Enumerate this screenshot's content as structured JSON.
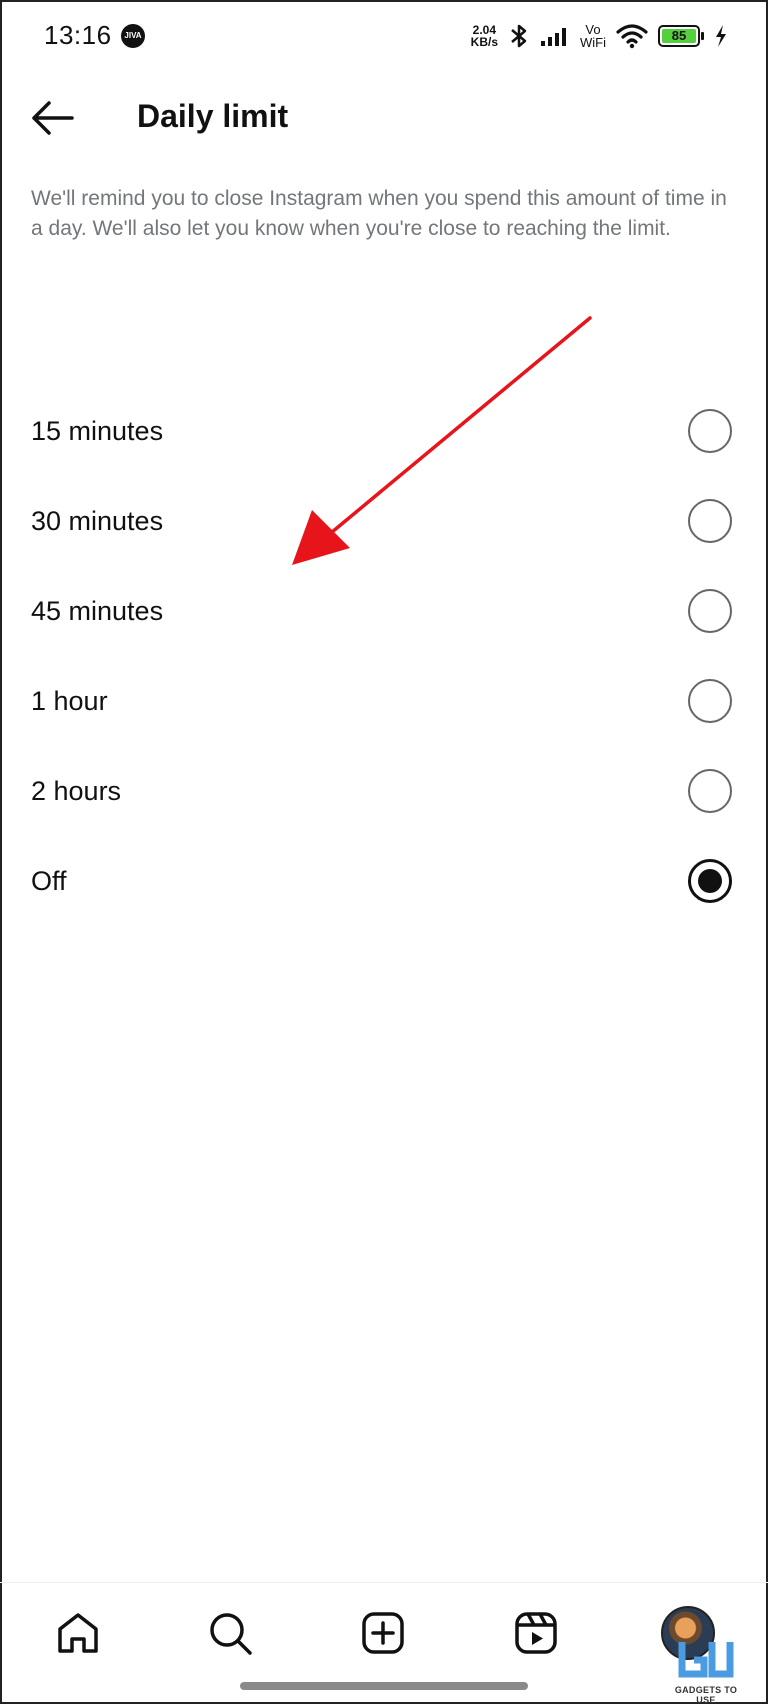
{
  "status_bar": {
    "time": "13:16",
    "app_icon_text": "JIVA",
    "net_speed_value": "2.04",
    "net_speed_unit": "KB/s",
    "vo_label": "Vo",
    "wifi_label": "WiFi",
    "battery_level": "85"
  },
  "header": {
    "title": "Daily limit"
  },
  "description": "We'll remind you to close Instagram when you spend this amount of time in a day. We'll also let you know when you're close to reaching the limit.",
  "options": [
    {
      "label": "15 minutes",
      "selected": false
    },
    {
      "label": "30 minutes",
      "selected": false
    },
    {
      "label": "45 minutes",
      "selected": false
    },
    {
      "label": "1 hour",
      "selected": false
    },
    {
      "label": "2 hours",
      "selected": false
    },
    {
      "label": "Off",
      "selected": true
    }
  ],
  "bottom_nav": [
    "home-icon",
    "search-icon",
    "create-icon",
    "reels-icon",
    "profile-avatar"
  ],
  "watermark": {
    "text": "GADGETS TO USE"
  },
  "colors": {
    "annotation_arrow": "#e8141c",
    "battery_fill": "#53d03b",
    "description_text": "#73777b"
  }
}
